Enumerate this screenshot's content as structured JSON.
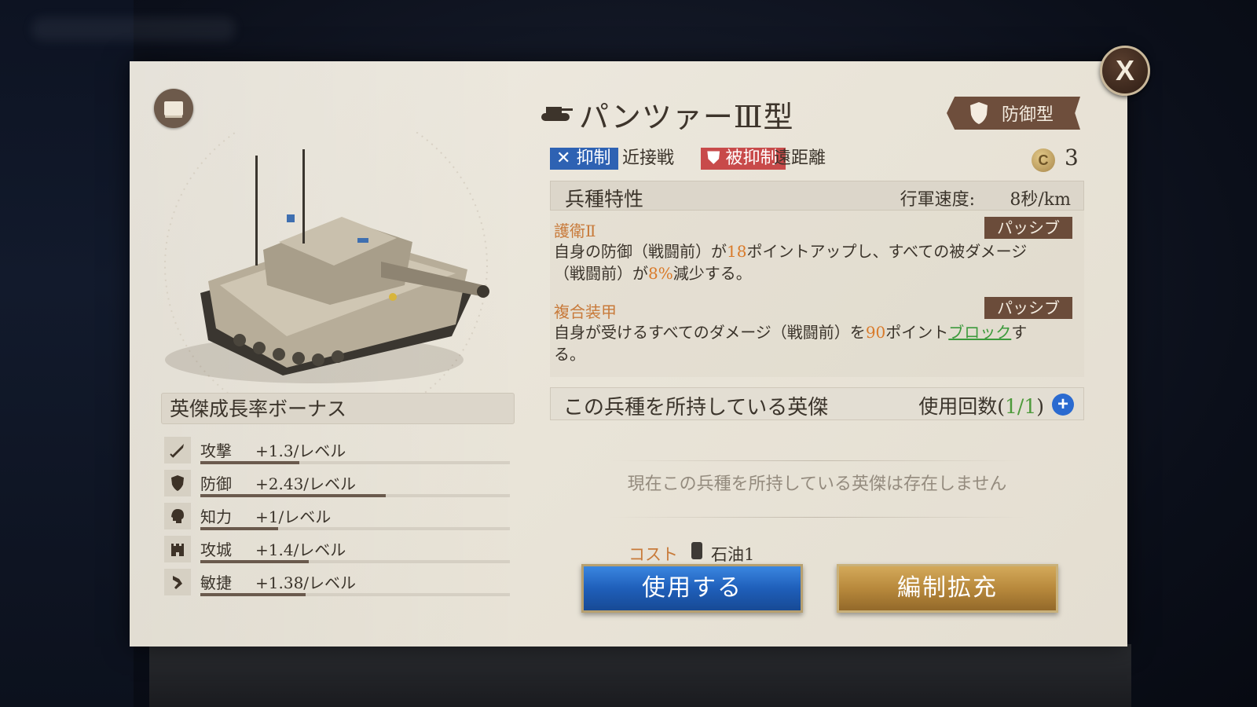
{
  "close_label": "X",
  "unit": {
    "name": "パンツァーⅢ型",
    "type": "防御型",
    "counter_tag": "抑制",
    "counter_target": "近接戦",
    "countered_tag": "被抑制",
    "countered_by": "遠距離",
    "cost_value": "3",
    "coin_letter": "C"
  },
  "growth": {
    "title": "英傑成長率ボーナス",
    "stats": [
      {
        "icon": "sword-icon",
        "name": "攻撃",
        "value": "+1.3/レベル",
        "fill": 0.32
      },
      {
        "icon": "shield-icon",
        "name": "防御",
        "value": "+2.43/レベル",
        "fill": 0.6
      },
      {
        "icon": "head-icon",
        "name": "知力",
        "value": "+1/レベル",
        "fill": 0.25
      },
      {
        "icon": "castle-icon",
        "name": "攻城",
        "value": "+1.4/レベル",
        "fill": 0.35
      },
      {
        "icon": "boot-icon",
        "name": "敏捷",
        "value": "+1.38/レベル",
        "fill": 0.34
      }
    ]
  },
  "traits": {
    "title": "兵種特性",
    "speed_label": "行軍速度:",
    "speed_value": "8秒/km",
    "skills": [
      {
        "name": "護衛Ⅱ",
        "badge": "パッシブ",
        "desc_a": "自身の防御（戦闘前）が",
        "hl_1": "18",
        "desc_b": "ポイントアップし、すべての被ダメージ（戦闘前）が",
        "hl_2": "8%",
        "desc_c": "減少する。"
      },
      {
        "name": "複合装甲",
        "badge": "パッシブ",
        "desc_a": "自身が受けるすべてのダメージ（戦闘前）を",
        "hl_1": "90",
        "desc_b": "ポイント",
        "link": "ブロック",
        "desc_c": "する。"
      }
    ]
  },
  "heroes": {
    "title": "この兵種を所持している英傑",
    "usage_prefix": "使用回数(",
    "usage_count": "1/1",
    "usage_suffix": ")",
    "plus": "+",
    "empty": "現在この兵種を所持している英傑は存在しません"
  },
  "actions": {
    "cost_label": "コスト",
    "cost_resource": "石油1",
    "use": "使用する",
    "expand": "編制拡充"
  },
  "colors": {
    "accent_orange": "#d97a2a",
    "use_button": "#1f5fba",
    "expand_button": "#b8893c",
    "badge_brown": "#6b4c3a",
    "counter_blue": "#2e62b3",
    "countered_red": "#c84a4a"
  }
}
